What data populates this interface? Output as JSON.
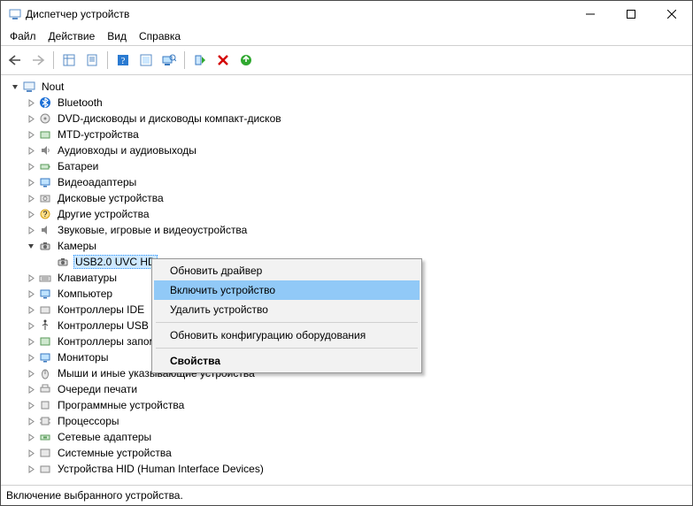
{
  "window": {
    "title": "Диспетчер устройств"
  },
  "menu": {
    "file": "Файл",
    "action": "Действие",
    "view": "Вид",
    "help": "Справка"
  },
  "tree": {
    "root": "Nout",
    "items": [
      "Bluetooth",
      "DVD-дисководы и дисководы компакт-дисков",
      "MTD-устройства",
      "Аудиовходы и аудиовыходы",
      "Батареи",
      "Видеоадаптеры",
      "Дисковые устройства",
      "Другие устройства",
      "Звуковые, игровые и видеоустройства",
      "Камеры",
      "Клавиатуры",
      "Компьютер",
      "Контроллеры IDE",
      "Контроллеры USB",
      "Контроллеры запоминающих устройств",
      "Мониторы",
      "Мыши и иные указывающие устройства",
      "Очереди печати",
      "Программные устройства",
      "Процессоры",
      "Сетевые адаптеры",
      "Системные устройства",
      "Устройства HID (Human Interface Devices)"
    ],
    "camera_device": "USB2.0 UVC HD"
  },
  "context": {
    "update": "Обновить драйвер",
    "enable": "Включить устройство",
    "uninstall": "Удалить устройство",
    "scan": "Обновить конфигурацию оборудования",
    "properties": "Свойства"
  },
  "status": "Включение выбранного устройства."
}
